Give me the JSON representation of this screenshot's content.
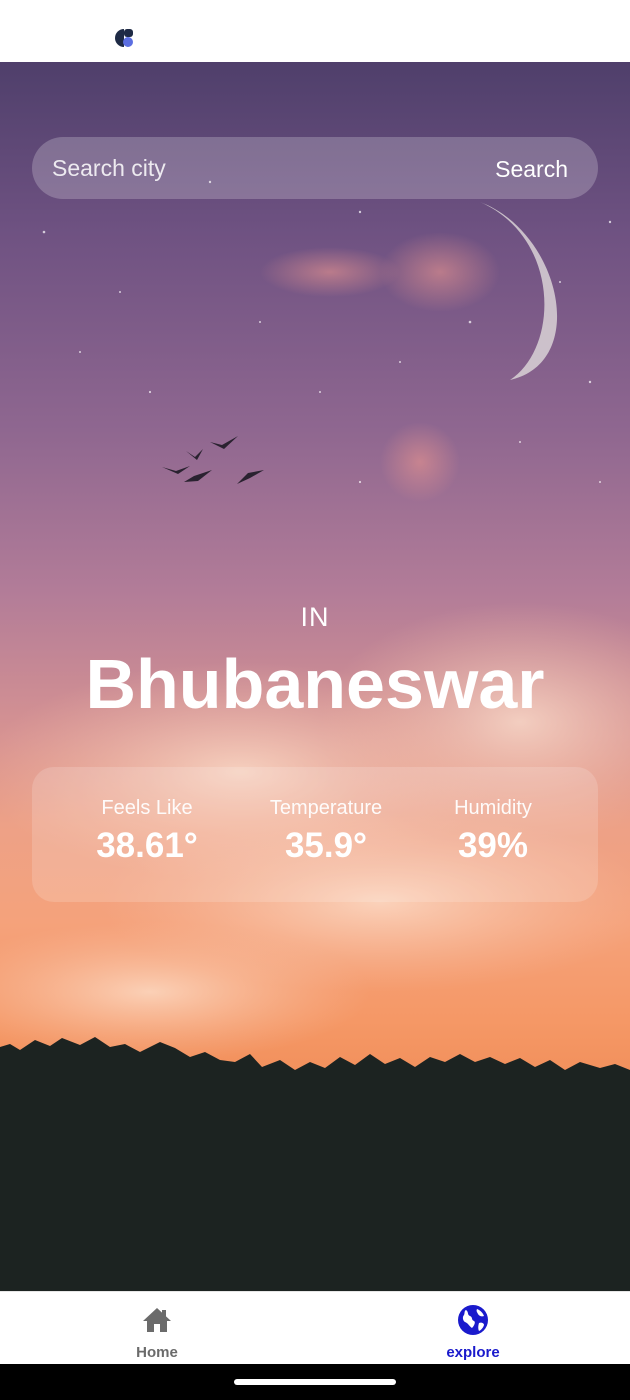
{
  "search": {
    "placeholder": "Search city",
    "button_label": "Search"
  },
  "location": {
    "country": "IN",
    "city": "Bhubaneswar"
  },
  "stats": [
    {
      "label": "Feels Like",
      "value": "38.61°"
    },
    {
      "label": "Temperature",
      "value": "35.9°"
    },
    {
      "label": "Humidity",
      "value": "39%"
    }
  ],
  "nav": {
    "items": [
      {
        "label": "Home",
        "icon": "home-icon",
        "active": false
      },
      {
        "label": "explore",
        "icon": "globe-icon",
        "active": true
      }
    ],
    "active_color": "#1a1acc",
    "inactive_color": "#6b6b6b"
  },
  "colors": {
    "text": "#ffffff",
    "status_icon": "#1e2a45",
    "status_icon_accent": "#5b6ee1"
  }
}
